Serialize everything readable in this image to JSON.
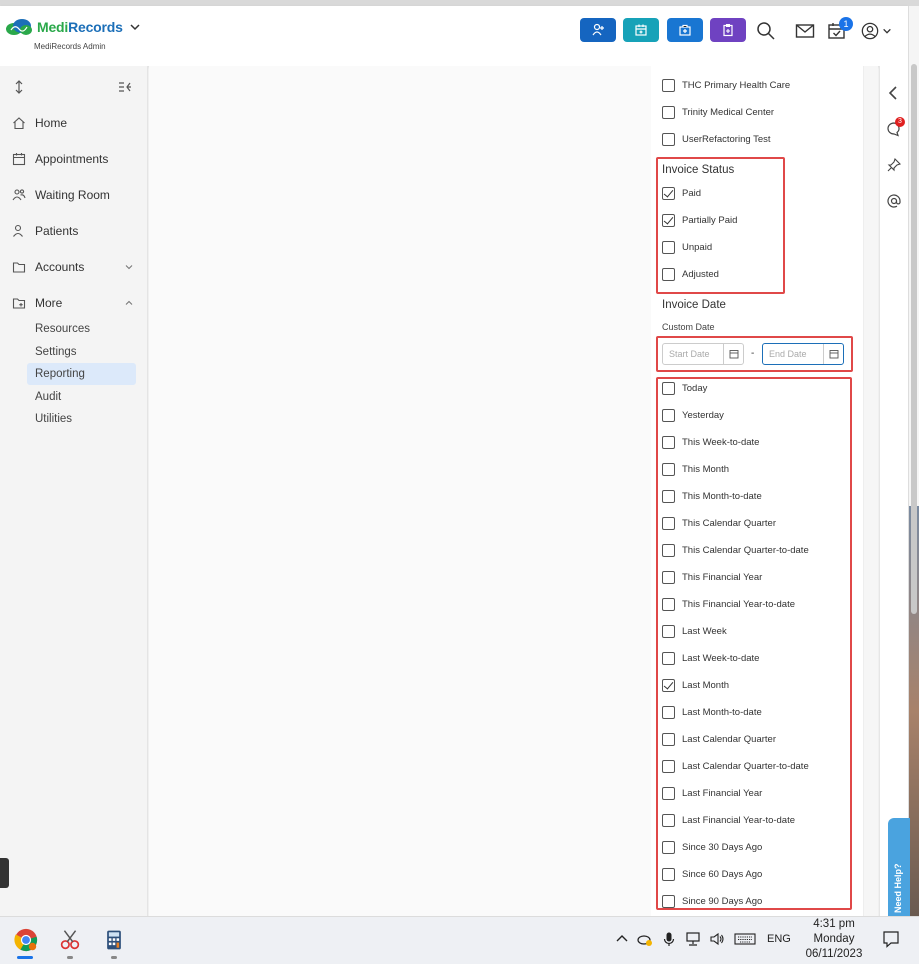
{
  "app": {
    "brand_medi": "Medi",
    "brand_records": "Records",
    "subtitle": "MediRecords Admin"
  },
  "header": {
    "notification_count": "1",
    "button_colors": [
      "#1565c0",
      "#17a2b8",
      "#1976d2",
      "#6f42c1"
    ]
  },
  "sidebar": {
    "items": [
      {
        "label": "Home",
        "icon": "home-icon"
      },
      {
        "label": "Appointments",
        "icon": "calendar-icon"
      },
      {
        "label": "Waiting Room",
        "icon": "people-icon"
      },
      {
        "label": "Patients",
        "icon": "user-icon"
      },
      {
        "label": "Accounts",
        "icon": "folder-icon"
      },
      {
        "label": "More",
        "icon": "folder-plus-icon"
      }
    ],
    "sub_items": [
      "Resources",
      "Settings",
      "Reporting",
      "Audit",
      "Utilities"
    ],
    "active_sub": "Reporting"
  },
  "filters": {
    "locations": [
      {
        "label": "THC Primary Health Care",
        "checked": false
      },
      {
        "label": "Trinity Medical Center",
        "checked": false
      },
      {
        "label": "UserRefactoring Test",
        "checked": false
      }
    ],
    "invoice_status_title": "Invoice Status",
    "invoice_status": [
      {
        "label": "Paid",
        "checked": true
      },
      {
        "label": "Partially Paid",
        "checked": true
      },
      {
        "label": "Unpaid",
        "checked": false
      },
      {
        "label": "Adjusted",
        "checked": false
      }
    ],
    "invoice_date_title": "Invoice Date",
    "custom_date_label": "Custom Date",
    "start_date_placeholder": "Start Date",
    "end_date_placeholder": "End Date",
    "date_separator": "-",
    "date_ranges": [
      {
        "label": "Today",
        "checked": false
      },
      {
        "label": "Yesterday",
        "checked": false
      },
      {
        "label": "This Week-to-date",
        "checked": false
      },
      {
        "label": "This Month",
        "checked": false
      },
      {
        "label": "This Month-to-date",
        "checked": false
      },
      {
        "label": "This Calendar Quarter",
        "checked": false
      },
      {
        "label": "This Calendar Quarter-to-date",
        "checked": false
      },
      {
        "label": "This Financial Year",
        "checked": false
      },
      {
        "label": "This Financial Year-to-date",
        "checked": false
      },
      {
        "label": "Last Week",
        "checked": false
      },
      {
        "label": "Last Week-to-date",
        "checked": false
      },
      {
        "label": "Last Month",
        "checked": true
      },
      {
        "label": "Last Month-to-date",
        "checked": false
      },
      {
        "label": "Last Calendar Quarter",
        "checked": false
      },
      {
        "label": "Last Calendar Quarter-to-date",
        "checked": false
      },
      {
        "label": "Last Financial Year",
        "checked": false
      },
      {
        "label": "Last Financial Year-to-date",
        "checked": false
      },
      {
        "label": "Since 30 Days Ago",
        "checked": false
      },
      {
        "label": "Since 60 Days Ago",
        "checked": false
      },
      {
        "label": "Since 90 Days Ago",
        "checked": false
      }
    ]
  },
  "rail": {
    "chat_badge": "3",
    "need_help": "Need Help?"
  },
  "taskbar": {
    "lang": "ENG",
    "time": "4:31 pm",
    "day": "Monday",
    "date": "06/11/2023"
  }
}
